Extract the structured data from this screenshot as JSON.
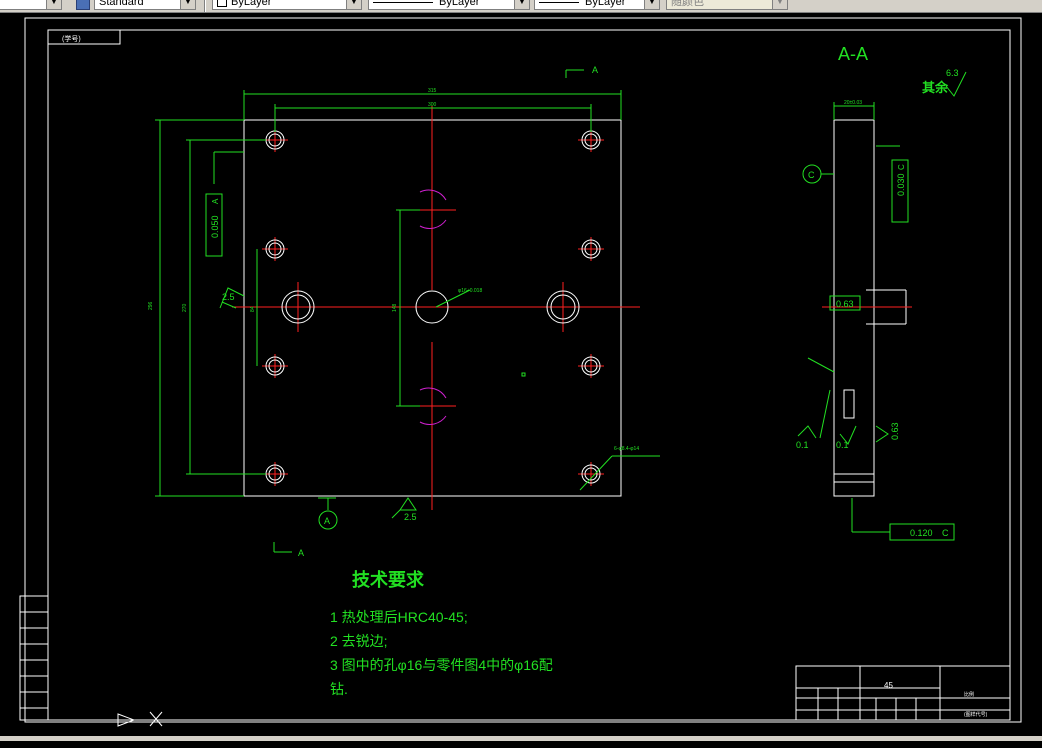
{
  "toolbar": {
    "textstyle_value": "Standard",
    "layer_value": "ByLayer",
    "linetype_value": "ByLayer",
    "lineweight_value": "ByLayer",
    "plotstyle_value": "随颜色"
  },
  "drawing": {
    "title_tag": "(学号)",
    "section_title": "A-A",
    "section_mark": "A",
    "tech_title": "技术要求",
    "tech_items": [
      "1   热处理后HRC40-45;",
      "2   去锐边;",
      "3    图中的孔φ16与零件图4中的φ16配",
      "钻."
    ],
    "roughness_rest": "其余",
    "roughness_rest_value": "6.3",
    "tol_perp_a": "0.050",
    "tol_datum_a": "A",
    "tol_parallel_c": "0.030",
    "tol_datum_c": "C",
    "tol_perp_c": "0.120",
    "tol_flat": "0.63",
    "rough_25": "2.5",
    "rough_01": "0.1",
    "rough_063": "0.63",
    "datum_a_label": "A",
    "datum_c_label": "C",
    "material": "45",
    "scale_mark": "比例",
    "company": "(图样代号)"
  }
}
